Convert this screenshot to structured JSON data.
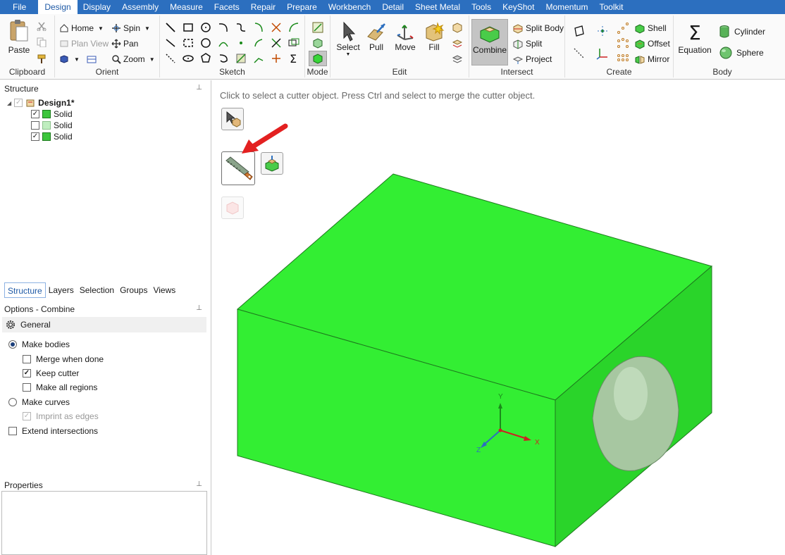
{
  "menu": {
    "items": [
      "File",
      "Design",
      "Display",
      "Assembly",
      "Measure",
      "Facets",
      "Repair",
      "Prepare",
      "Workbench",
      "Detail",
      "Sheet Metal",
      "Tools",
      "KeyShot",
      "Momentum",
      "Toolkit"
    ],
    "active_index": 1
  },
  "ribbon": {
    "clipboard": {
      "label": "Clipboard",
      "paste": "Paste"
    },
    "orient": {
      "label": "Orient",
      "home": "Home",
      "spin": "Spin",
      "plan_view": "Plan View",
      "pan": "Pan",
      "zoom": "Zoom"
    },
    "sketch": {
      "label": "Sketch"
    },
    "mode": {
      "label": "Mode"
    },
    "edit": {
      "label": "Edit",
      "select": "Select",
      "pull": "Pull",
      "move": "Move",
      "fill": "Fill"
    },
    "intersect": {
      "label": "Intersect",
      "combine": "Combine",
      "split_body": "Split Body",
      "split": "Split",
      "project": "Project"
    },
    "create": {
      "label": "Create",
      "shell": "Shell",
      "offset": "Offset",
      "mirror": "Mirror"
    },
    "body": {
      "label": "Body",
      "equation": "Equation",
      "cylinder": "Cylinder",
      "sphere": "Sphere"
    }
  },
  "structure": {
    "title": "Structure",
    "root": "Design1*",
    "items": [
      {
        "label": "Solid",
        "checked": true
      },
      {
        "label": "Solid",
        "checked": false
      },
      {
        "label": "Solid",
        "checked": true
      }
    ]
  },
  "panel_tabs": [
    "Structure",
    "Layers",
    "Selection",
    "Groups",
    "Views"
  ],
  "options": {
    "title": "Options - Combine",
    "section": "General",
    "make_bodies": "Make bodies",
    "merge_when_done": "Merge when done",
    "keep_cutter": "Keep cutter",
    "make_all_regions": "Make all regions",
    "make_curves": "Make curves",
    "imprint_as_edges": "Imprint as edges",
    "extend_intersections": "Extend intersections"
  },
  "properties": {
    "title": "Properties"
  },
  "viewport": {
    "hint": "Click to select a cutter object. Press Ctrl and select to merge the cutter object."
  },
  "axes": {
    "x": "X",
    "y": "Y",
    "z": "Z"
  },
  "colors": {
    "menubar": "#2c6fbf",
    "body_green": "#33ee33",
    "sphere": "#a7c7a1",
    "arrow": "#e32020"
  }
}
